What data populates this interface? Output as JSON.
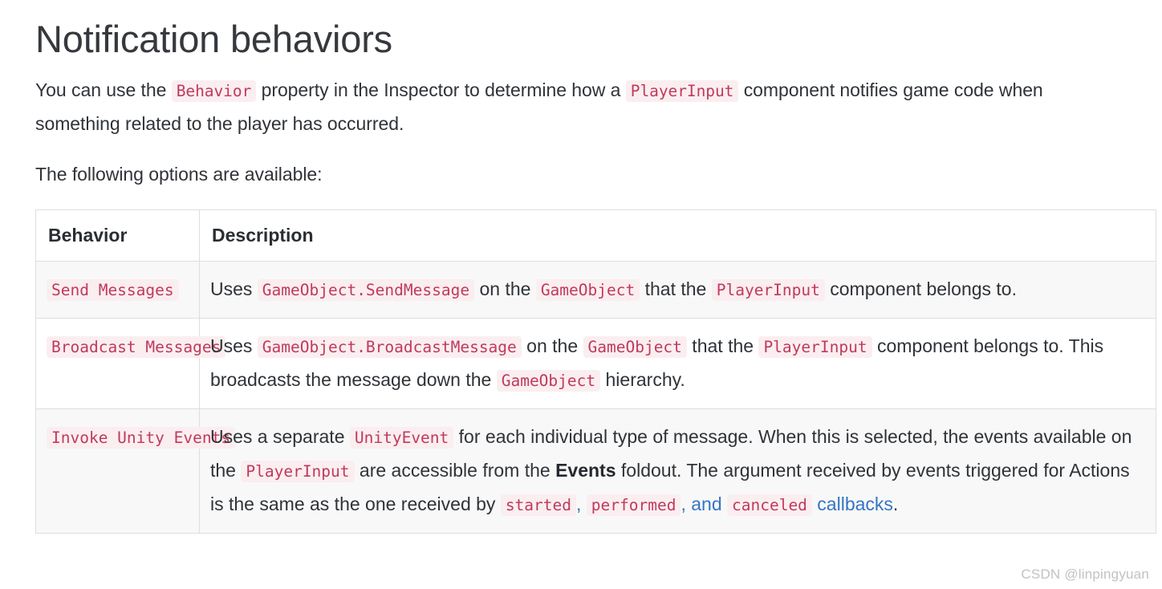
{
  "page": {
    "title": "Notification behaviors",
    "intro_parts": {
      "a": "You can use the ",
      "code1": "Behavior",
      "b": " property in the Inspector to determine how a ",
      "code2": "PlayerInput",
      "c": " component notifies game code when something related to the player has occurred."
    },
    "second_para": "The following options are available:"
  },
  "table": {
    "headers": {
      "behavior": "Behavior",
      "description": "Description"
    },
    "rows": [
      {
        "behavior_code": "Send Messages",
        "description": {
          "t1": "Uses ",
          "c1": "GameObject.SendMessage",
          "t2": " on the ",
          "c2": "GameObject",
          "t3": " that the ",
          "c3": "PlayerInput",
          "t4": " component belongs to."
        }
      },
      {
        "behavior_code": "Broadcast Messages",
        "description": {
          "t1": "Uses ",
          "c1": "GameObject.BroadcastMessage",
          "t2": " on the ",
          "c2": "GameObject",
          "t3": " that the ",
          "c3": "PlayerInput",
          "t4": " component belongs to. This broadcasts the message down the ",
          "c4": "GameObject",
          "t5": " hierarchy."
        }
      },
      {
        "behavior_code": "Invoke Unity Events",
        "description": {
          "t1": "Uses a separate ",
          "c1": "UnityEvent",
          "t2": " for each individual type of message. When this is selected, the events available on the ",
          "c2": "PlayerInput",
          "t3": " are accessible from the ",
          "bold1": "Events",
          "t4": " foldout. The argument received by events triggered for Actions is the same as the one received by ",
          "link": {
            "c_started": "started",
            "sep1": ", ",
            "c_performed": "performed",
            "sep2": ", and ",
            "c_canceled": "canceled",
            "tail": " callbacks"
          },
          "t5": "."
        }
      }
    ]
  },
  "watermark": "CSDN @linpingyuan",
  "colors": {
    "code_text": "#c03a5b",
    "code_bg": "#faeef1",
    "link": "#3475c4",
    "row_odd_bg": "#f8f8f8",
    "border": "#dedede",
    "text": "#2f3338"
  }
}
